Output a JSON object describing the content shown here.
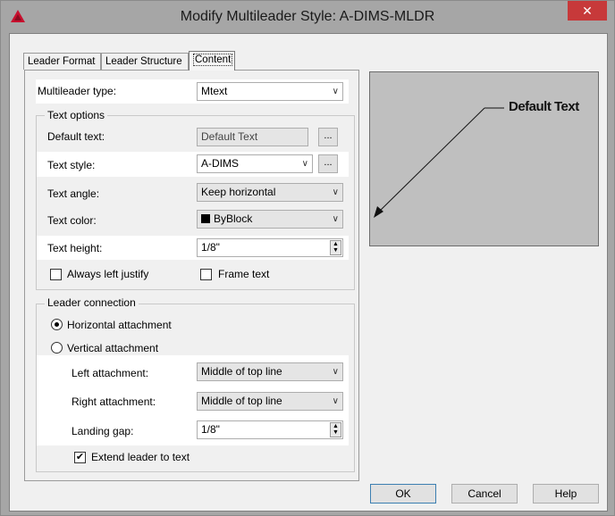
{
  "window": {
    "title": "Modify Multileader Style: A-DIMS-MLDR",
    "close_glyph": "✕"
  },
  "tabs": [
    "Leader Format",
    "Leader Structure",
    "Content"
  ],
  "content": {
    "multileader_type": {
      "label": "Multileader type:",
      "value": "Mtext"
    },
    "text_options": {
      "legend": "Text options",
      "default_text": {
        "label": "Default text:",
        "value": "Default Text"
      },
      "text_style": {
        "label": "Text style:",
        "value": "A-DIMS"
      },
      "text_angle": {
        "label": "Text angle:",
        "value": "Keep horizontal"
      },
      "text_color": {
        "label": "Text color:",
        "value": "ByBlock"
      },
      "text_height": {
        "label": "Text height:",
        "value": "1/8\""
      },
      "always_left_justify": {
        "label": "Always left justify",
        "checked": false
      },
      "frame_text": {
        "label": "Frame text",
        "checked": false
      }
    },
    "leader_connection": {
      "legend": "Leader connection",
      "horizontal": {
        "label": "Horizontal attachment",
        "selected": true
      },
      "vertical": {
        "label": "Vertical attachment",
        "selected": false
      },
      "left_attachment": {
        "label": "Left attachment:",
        "value": "Middle of top line"
      },
      "right_attachment": {
        "label": "Right attachment:",
        "value": "Middle of top line"
      },
      "landing_gap": {
        "label": "Landing gap:",
        "value": "1/8\""
      },
      "extend_leader": {
        "label": "Extend leader to text",
        "checked": true
      }
    }
  },
  "preview": {
    "text": "Default Text"
  },
  "buttons": {
    "ok": "OK",
    "cancel": "Cancel",
    "help": "Help"
  },
  "glyphs": {
    "ellipsis": "...",
    "dropdown": "∨",
    "spin_up": "▲",
    "spin_down": "▼",
    "check": "✔"
  },
  "colors": {
    "text_color_swatch": "#000000",
    "close_button": "#c7393a",
    "highlight_row": "#ffffff"
  }
}
